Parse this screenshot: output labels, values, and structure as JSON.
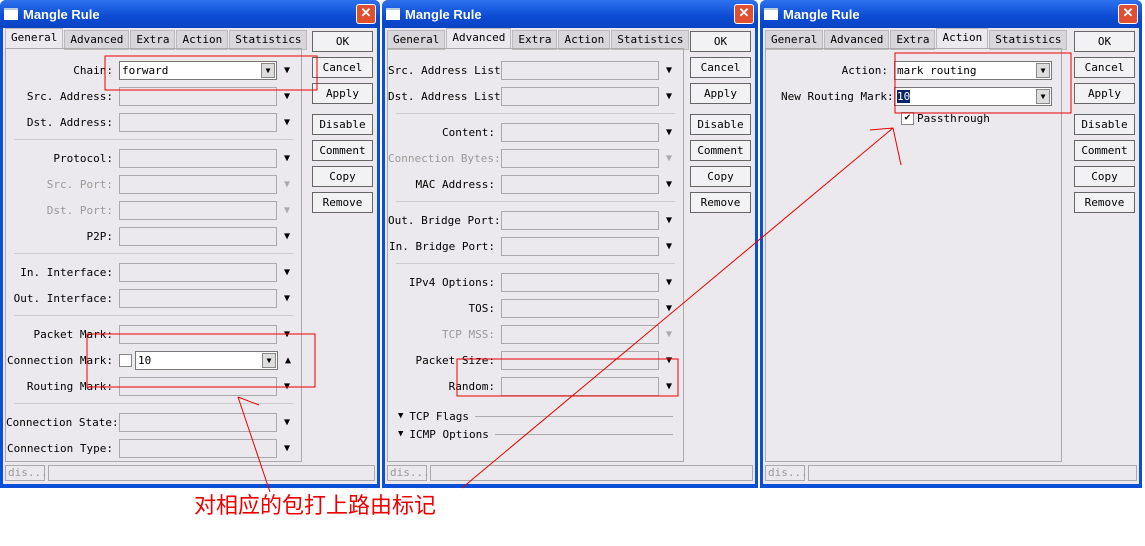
{
  "window_title": "Mangle Rule",
  "tabs": [
    "General",
    "Advanced",
    "Extra",
    "Action",
    "Statistics"
  ],
  "buttons": [
    "OK",
    "Cancel",
    "Apply",
    "Disable",
    "Comment",
    "Copy",
    "Remove"
  ],
  "status": "dis...",
  "windows": [
    {
      "active_tab": 0,
      "rows": [
        {
          "label": "Chain:",
          "value": "forward",
          "editable": true
        },
        {
          "label": "Src. Address:"
        },
        {
          "label": "Dst. Address:"
        },
        {
          "sep": true
        },
        {
          "label": "Protocol:"
        },
        {
          "label": "Src. Port:",
          "disabled": true
        },
        {
          "label": "Dst. Port:",
          "disabled": true
        },
        {
          "label": "P2P:"
        },
        {
          "sep": true
        },
        {
          "label": "In. Interface:"
        },
        {
          "label": "Out. Interface:"
        },
        {
          "sep": true
        },
        {
          "label": "Packet Mark:"
        },
        {
          "label": "Connection Mark:",
          "value": "10",
          "editable": true,
          "checkbox": true,
          "expanded": true
        },
        {
          "label": "Routing Mark:"
        },
        {
          "sep": true
        },
        {
          "label": "Connection State:"
        },
        {
          "label": "Connection Type:"
        }
      ]
    },
    {
      "active_tab": 1,
      "rows": [
        {
          "label": "Src. Address List:"
        },
        {
          "label": "Dst. Address List:"
        },
        {
          "sep": true
        },
        {
          "label": "Content:"
        },
        {
          "label": "Connection Bytes:",
          "disabled": true
        },
        {
          "label": "MAC Address:"
        },
        {
          "sep": true
        },
        {
          "label": "Out. Bridge Port:"
        },
        {
          "label": "In. Bridge Port:"
        },
        {
          "sep": true
        },
        {
          "label": "IPv4 Options:"
        },
        {
          "label": "TOS:"
        },
        {
          "label": "TCP MSS:",
          "disabled": true
        },
        {
          "label": "Packet Size:"
        },
        {
          "label": "Random:"
        }
      ],
      "sections": [
        "TCP Flags",
        "ICMP Options"
      ]
    },
    {
      "active_tab": 3,
      "rows": [
        {
          "label": "Action:",
          "value": "mark routing",
          "editable": true
        },
        {
          "label": "New Routing Mark:",
          "value": "10",
          "editable": true,
          "selected": true
        }
      ],
      "passthrough": {
        "label": "Passthrough",
        "checked": true
      }
    }
  ],
  "annotation": "对相应的包打上路由标记",
  "annotation_color": "#e00000"
}
